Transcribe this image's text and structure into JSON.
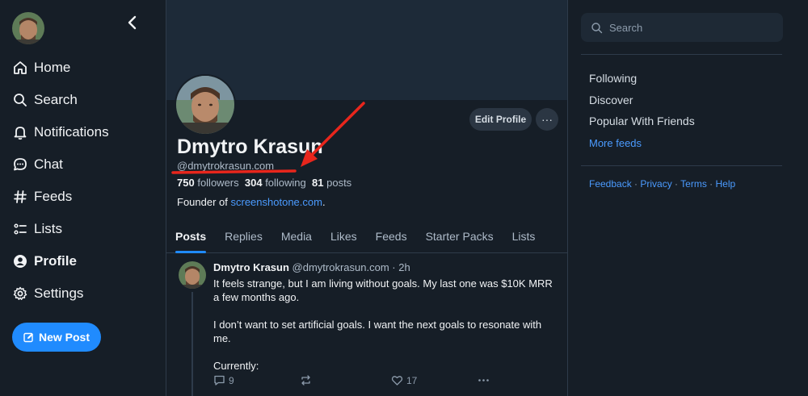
{
  "sidebar": {
    "items": [
      {
        "label": "Home",
        "icon": "home-icon"
      },
      {
        "label": "Search",
        "icon": "search-icon"
      },
      {
        "label": "Notifications",
        "icon": "bell-icon"
      },
      {
        "label": "Chat",
        "icon": "chat-icon"
      },
      {
        "label": "Feeds",
        "icon": "hash-icon"
      },
      {
        "label": "Lists",
        "icon": "list-icon"
      },
      {
        "label": "Profile",
        "icon": "user-circle-icon",
        "active": true
      },
      {
        "label": "Settings",
        "icon": "gear-icon"
      }
    ],
    "new_post_label": "New Post"
  },
  "profile": {
    "display_name": "Dmytro Krasun",
    "handle": "@dmytrokrasun.com",
    "followers_count": "750",
    "followers_label": "followers",
    "following_count": "304",
    "following_label": "following",
    "posts_count": "81",
    "posts_label": "posts",
    "bio_prefix": "Founder of ",
    "bio_link": "screenshotone.com",
    "bio_suffix": ".",
    "edit_label": "Edit Profile",
    "more_label": "···"
  },
  "tabs": [
    "Posts",
    "Replies",
    "Media",
    "Likes",
    "Feeds",
    "Starter Packs",
    "Lists"
  ],
  "active_tab": "Posts",
  "post": {
    "author": "Dmytro Krasun",
    "handle_time": "@dmytrokrasun.com · 2h",
    "paragraphs": [
      "It feels strange, but I am living without goals. My last one was $10K MRR a few months ago.",
      "I don’t want to set artificial goals. I want the next goals to resonate with me.",
      "Currently:"
    ],
    "reply_count": "9",
    "repost_count": "",
    "like_count": "17"
  },
  "right": {
    "search_placeholder": "Search",
    "feeds": [
      "Following",
      "Discover",
      "Popular With Friends"
    ],
    "more_feeds": "More feeds",
    "footer": [
      "Feedback",
      "Privacy",
      "Terms",
      "Help"
    ],
    "footer_sep": " · "
  },
  "colors": {
    "background": "#161e27",
    "accent": "#208bfe",
    "annotation": "#e8261c"
  }
}
